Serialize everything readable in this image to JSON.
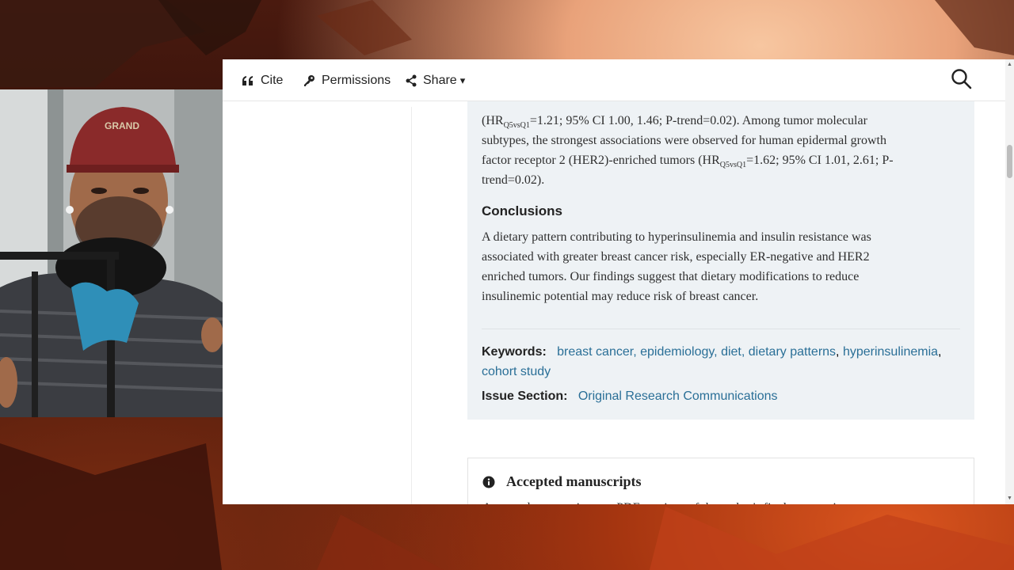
{
  "toolbar": {
    "cite_label": "Cite",
    "permissions_label": "Permissions",
    "share_label": "Share",
    "share_caret": "▾"
  },
  "abstract": {
    "results_line1_pre": "(HR",
    "results_line1_sub": "Q5vsQ1",
    "results_line1_post": "=1.21; 95% CI 1.00, 1.46; P-trend=0.02). Among tumor molecular",
    "results_line2": "subtypes, the strongest associations were observed for human epidermal growth",
    "results_line3_pre": "factor receptor 2 (HER2)-enriched tumors (HR",
    "results_line3_sub": "Q5vsQ1",
    "results_line3_post": "=1.62; 95% CI 1.01, 2.61; P-",
    "results_line4": "trend=0.02).",
    "conclusions_heading": "Conclusions",
    "conclusions_line1": "A dietary pattern contributing to hyperinsulinemia and insulin resistance was",
    "conclusions_line2": "associated with greater breast cancer risk, especially ER-negative and HER2",
    "conclusions_line3": "enriched tumors. Our findings suggest that dietary modifications to reduce",
    "conclusions_line4": "insulinemic potential may reduce risk of breast cancer."
  },
  "keywords": {
    "label": "Keywords:",
    "items": [
      "breast cancer, epidemiology, diet, dietary patterns",
      "hyperinsulinemia",
      "cohort study"
    ],
    "separator": ","
  },
  "issue_section": {
    "label": "Issue Section:",
    "value": "Original Research Communications"
  },
  "accepted": {
    "heading": "Accepted manuscripts",
    "text_cut": "Accepted manuscripts are PDF versions of the author's final manuscript"
  },
  "colors": {
    "link": "#2a6f97",
    "abstract_bg": "#eef2f5"
  }
}
